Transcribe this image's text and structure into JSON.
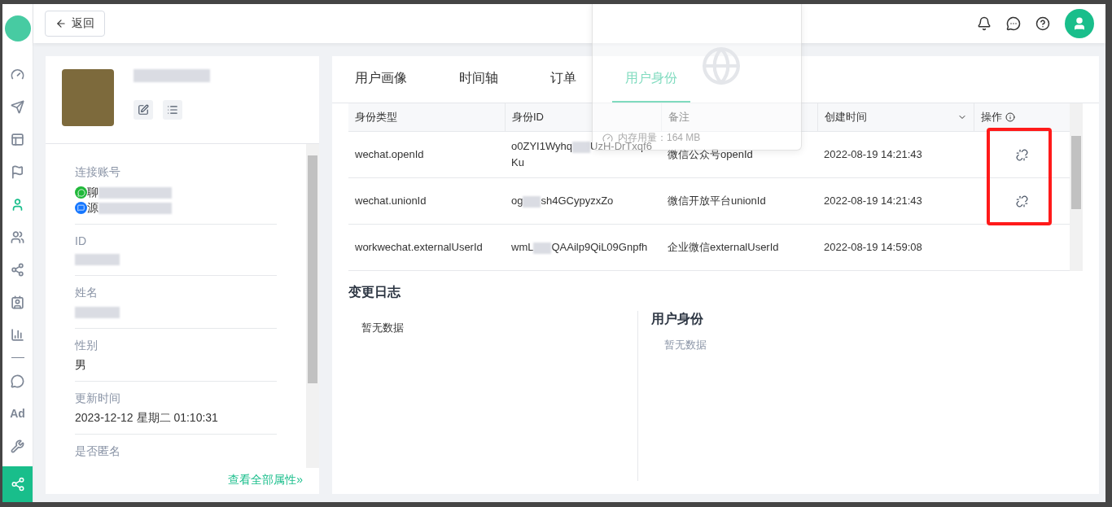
{
  "topbar": {
    "back_button": "返回"
  },
  "sidebar": {
    "items": [
      {
        "kind": "icon",
        "selected": false
      },
      {
        "kind": "icon",
        "selected": false
      },
      {
        "kind": "icon",
        "selected": false
      },
      {
        "kind": "icon",
        "selected": false
      },
      {
        "kind": "icon",
        "selected": true
      },
      {
        "kind": "icon",
        "selected": false
      },
      {
        "kind": "icon",
        "selected": false
      },
      {
        "kind": "icon",
        "selected": false
      },
      {
        "kind": "icon",
        "selected": false
      },
      {
        "kind": "divider"
      },
      {
        "kind": "icon",
        "selected": false
      },
      {
        "kind": "text",
        "label": "Ad",
        "selected": false
      },
      {
        "kind": "icon",
        "selected": false
      }
    ],
    "bottom_item": {
      "selected": true
    }
  },
  "profile": {
    "attributes": [
      {
        "label": "连接账号",
        "kind": "accounts",
        "accounts": [
          {
            "kind": "wechat",
            "text": "聊"
          },
          {
            "kind": "chat",
            "text": "源"
          }
        ]
      },
      {
        "label": "ID",
        "kind": "redacted"
      },
      {
        "label": "姓名",
        "kind": "redacted"
      },
      {
        "label": "性别",
        "kind": "text",
        "value": "男"
      },
      {
        "label": "更新时间",
        "kind": "text",
        "value": "2023-12-12 星期二 01:10:31"
      },
      {
        "label": "是否匿名",
        "kind": "empty"
      }
    ],
    "view_all_link": "查看全部属性»"
  },
  "tabs": [
    {
      "label": "用户画像",
      "selected": false
    },
    {
      "label": "时间轴",
      "selected": false
    },
    {
      "label": "订单",
      "selected": false
    },
    {
      "label": "用户身份",
      "selected": true
    }
  ],
  "table": {
    "columns": [
      "身份类型",
      "身份ID",
      "备注",
      "创建时间",
      "操作"
    ],
    "rows": [
      {
        "type": "wechat.openId",
        "id_parts": [
          "o0ZYI1Wyhq",
          "UzH-DrTxqf6Ku"
        ],
        "note": "微信公众号openId",
        "created": "2022-08-19 14:21:43",
        "unlink": true,
        "highlighted": true
      },
      {
        "type": "wechat.unionId",
        "id_parts": [
          "og",
          "sh4GCypyzxZo"
        ],
        "note": "微信开放平台unionId",
        "created": "2022-08-19 14:21:43",
        "unlink": true,
        "highlighted": true
      },
      {
        "type": "workwechat.externalUserId",
        "id_parts": [
          "wmL",
          "QAAilp9QiL09Gnpfh"
        ],
        "note": "企业微信externalUserId",
        "created": "2022-08-19 14:59:08",
        "unlink": false,
        "highlighted": false
      }
    ]
  },
  "changelog": {
    "title": "变更日志",
    "empty_text": "暂无数据",
    "identity_title": "用户身份",
    "identity_empty": "暂无数据"
  },
  "memory_overlay": {
    "label": "内存用量：164 MB"
  }
}
